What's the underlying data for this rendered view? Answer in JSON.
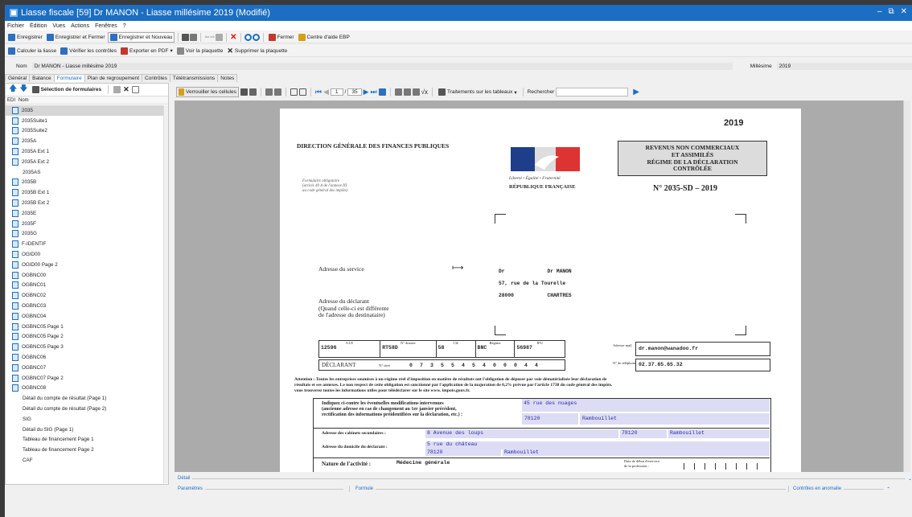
{
  "window": {
    "title": "Liasse fiscale [59] Dr MANON - Liasse millésime 2019 (Modifié)"
  },
  "menu": [
    "Fichier",
    "Édition",
    "Vues",
    "Actions",
    "Fenêtres",
    "?"
  ],
  "toolbar1": {
    "save": "Enregistrer",
    "save_close": "Enregistrer et Fermer",
    "save_new": "Enregistrer et Nouveau",
    "close": "Fermer",
    "help": "Centre d'aide EBP"
  },
  "toolbar2": {
    "calc": "Calculer la liasse",
    "check": "Vérifier les contrôles",
    "export": "Exporter en PDF",
    "view": "Voir la plaquette",
    "delete": "Supprimer la plaquette"
  },
  "namebar": {
    "label": "Nom",
    "value": "Dr MANON - Liasse millésime 2019",
    "mill_label": "Millésime",
    "mill_value": "2019"
  },
  "tabs": [
    "Général",
    "Balance",
    "Formulaire",
    "Plan de regroupement",
    "Contrôles",
    "Télétransmissions",
    "Notes"
  ],
  "left": {
    "tool_label": "Sélection de formulaires",
    "col_edi": "EDI",
    "col_name": "Nom",
    "items": [
      {
        "label": "2035",
        "doc": true
      },
      {
        "label": "2035Suite1",
        "doc": true
      },
      {
        "label": "2035Suite2",
        "doc": true
      },
      {
        "label": "2035A",
        "doc": true
      },
      {
        "label": "2035A Ext 1",
        "doc": true
      },
      {
        "label": "2035A Ext 2",
        "doc": true
      },
      {
        "label": "2035AS",
        "doc": false
      },
      {
        "label": "2035B",
        "doc": true
      },
      {
        "label": "2035B Ext 1",
        "doc": true
      },
      {
        "label": "2035B Ext 2",
        "doc": true
      },
      {
        "label": "2035E",
        "doc": true
      },
      {
        "label": "2035F",
        "doc": true
      },
      {
        "label": "2035G",
        "doc": true
      },
      {
        "label": "F-IDENTIF",
        "doc": true
      },
      {
        "label": "OGID00",
        "doc": true
      },
      {
        "label": "OGID00 Page 2",
        "doc": true
      },
      {
        "label": "OGBNC00",
        "doc": true
      },
      {
        "label": "OGBNC01",
        "doc": true
      },
      {
        "label": "OGBNC02",
        "doc": true
      },
      {
        "label": "OGBNC03",
        "doc": true
      },
      {
        "label": "OGBNC04",
        "doc": true
      },
      {
        "label": "OGBNC05 Page 1",
        "doc": true
      },
      {
        "label": "OGBNC05 Page 2",
        "doc": true
      },
      {
        "label": "OGBNC05 Page 3",
        "doc": true
      },
      {
        "label": "OGBNC06",
        "doc": true
      },
      {
        "label": "OGBNC07",
        "doc": true
      },
      {
        "label": "OGBNC07 Page 2",
        "doc": true
      },
      {
        "label": "OGBNC08",
        "doc": true
      },
      {
        "label": "Détail du compte de résultat (Page 1)",
        "doc": false
      },
      {
        "label": "Détail du compte de résultat (Page 2)",
        "doc": false
      },
      {
        "label": "SIG",
        "doc": false
      },
      {
        "label": "Détail du SIG (Page 1)",
        "doc": false
      },
      {
        "label": "Tableau de financement Page 1",
        "doc": false
      },
      {
        "label": "Tableau de financement Page 2",
        "doc": false
      },
      {
        "label": "CAF",
        "doc": false
      }
    ]
  },
  "doctool": {
    "lock": "Verrouiller les cellules",
    "page": "1",
    "pages": "35",
    "treatments": "Traitements sur les tableaux",
    "search": "Rechercher"
  },
  "form": {
    "year": "2019",
    "dgfip": "DIRECTION GÉNÉRALE DES FINANCES PUBLIQUES",
    "title_lines": [
      "REVENUS NON COMMERCIAUX",
      "ET ASSIMILÉS",
      "RÉGIME DE LA DÉCLARATION",
      "CONTRÔLÉE"
    ],
    "number": "N° 2035-SD – 2019",
    "oblig": [
      "Formulaire obligatoire",
      "(article 40 A de l'annexe III",
      "au code général des impôts)"
    ],
    "motto": "Liberté • Égalité • Fraternité",
    "republic": "RÉPUBLIQUE FRANÇAISE",
    "service_label": "Adresse du service",
    "declarant_label": [
      "Adresse du déclarant",
      "(Quand celle-ci est différente",
      "de l'adresse du destinataire)"
    ],
    "addr": [
      "Dr              Dr MANON",
      "57, rue de la Tourelle",
      "28000           CHARTRES"
    ],
    "hdr": [
      "S.I.E",
      "N° dossier",
      "Clé",
      "Régime",
      "IFU"
    ],
    "vals": [
      "12596",
      "RT58D",
      "58",
      "BNC",
      "56987"
    ],
    "declarant": "DÉCLARANT",
    "siret_label": "N° siret",
    "siret": "0 7 3 5 5 4 5 4 0 0 0 4 4",
    "email_label": "Adresse mail",
    "email": "dr.manon@wanadoo.fr",
    "phone_label": "N° de téléphone",
    "phone": "02.37.85.65.32",
    "attention": [
      "Attention : Toutes les entreprises soumises à un régime réel d'imposition en matière de résultats ont l'obligation de déposer par voie dématérialisée leur déclaration de",
      "résultats et ses annexes. Le non respect de cette obligation est sanctionné par l'application de la majoration de 0,2% prévue par l'article 1738 du code général des impôts.",
      "vous trouverez toutes les informations utiles pour télédéclarer sur le site www. impots.gouv.fr."
    ],
    "modif_label": [
      "Indiquez ci-contre les éventuelles modifications intervenues",
      "(ancienne adresse en cas de changement au 1er janvier précédent,",
      "rectification des informations préidentifiées sur la déclaration, etc.) :"
    ],
    "modif_street": "45 rue des nuages",
    "modif_zip": "78120",
    "modif_city": "Rambouillet",
    "cab_label": "Adresse des cabinets secondaires :",
    "cab_street": "8 Avenue des loups",
    "cab_zip": "78120",
    "cab_city": "Rambouillet",
    "dom_label": "Adresse du domicile du déclarant :",
    "dom_street": "5 rue du château",
    "dom_zip": "78120",
    "dom_city": "Rambouillet",
    "nature_label": "Nature de l'activité :",
    "nature": "Médecine générale",
    "debut_label": [
      "Date de début d'exercice",
      "de la profession :"
    ]
  },
  "bottom": {
    "detail": "Détail",
    "params": "Paramètres",
    "formule": "Formule",
    "controls": "Contrôles en anomalie"
  },
  "colors": {
    "accent": "#1b6ec2",
    "field_fill": "#dcdcf5",
    "field_text": "#2a2aa8"
  }
}
